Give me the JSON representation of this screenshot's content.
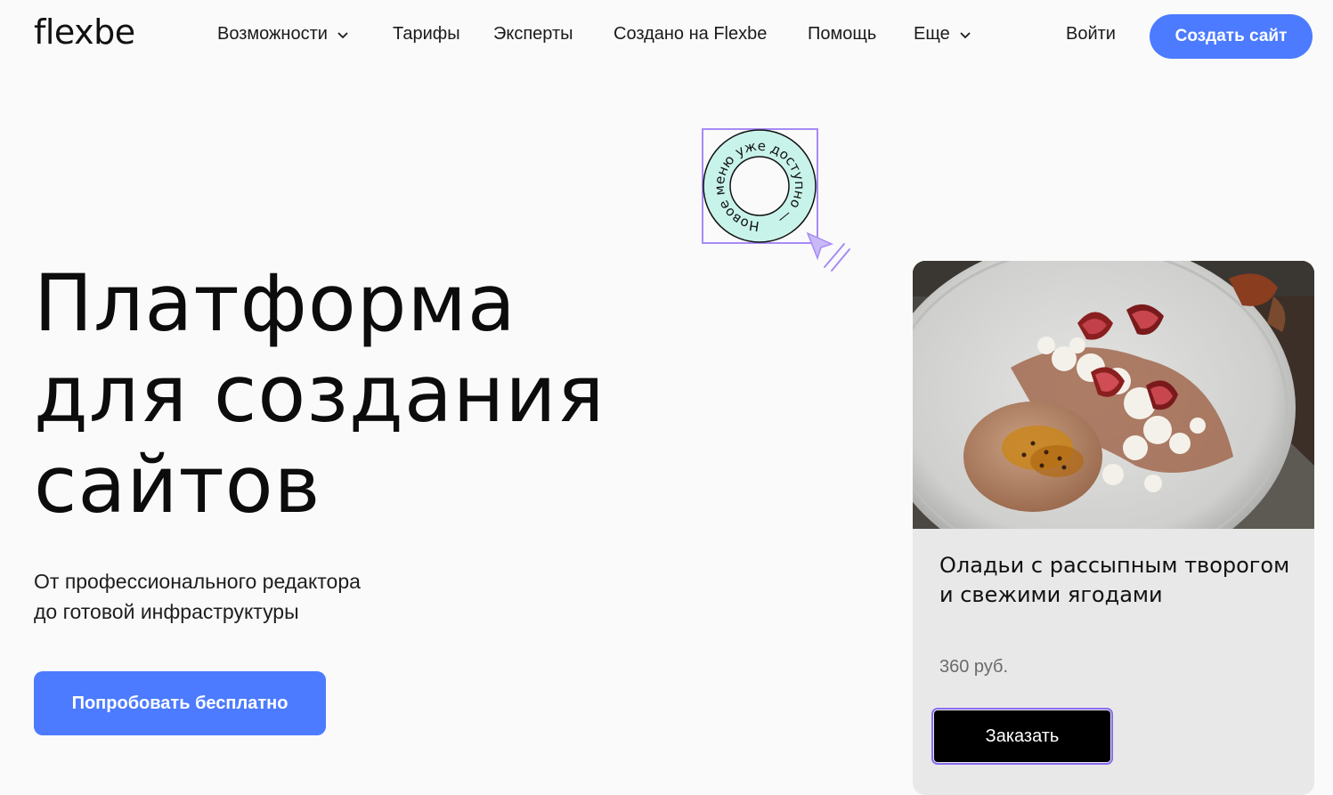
{
  "header": {
    "logo": "flexbe",
    "nav": [
      {
        "label": "Возможности",
        "has_dropdown": true
      },
      {
        "label": "Тарифы",
        "has_dropdown": false
      },
      {
        "label": "Эксперты",
        "has_dropdown": false
      },
      {
        "label": "Создано на Flexbe",
        "has_dropdown": false
      },
      {
        "label": "Помощь",
        "has_dropdown": false
      },
      {
        "label": "Еще",
        "has_dropdown": true
      }
    ],
    "login": "Войти",
    "create_button": "Создать сайт"
  },
  "hero": {
    "title_lines": [
      "Платформа",
      "для создания",
      "сайтов"
    ],
    "subtitle_lines": [
      "От профессионального редактора",
      "до готовой инфраструктуры"
    ],
    "cta": "Попробовать бесплатно"
  },
  "badge": {
    "circular_text": "Новое меню уже доступно —"
  },
  "card": {
    "title": "Оладьи с рассыпным творогом и свежими ягодами",
    "price": "360 руб.",
    "order_button": "Заказать"
  },
  "colors": {
    "accent": "#4c7bff",
    "background": "#fafafa",
    "badge_fill": "#c8f3ea",
    "selection": "#a78bf5",
    "card_bg": "#e8e8e8"
  }
}
